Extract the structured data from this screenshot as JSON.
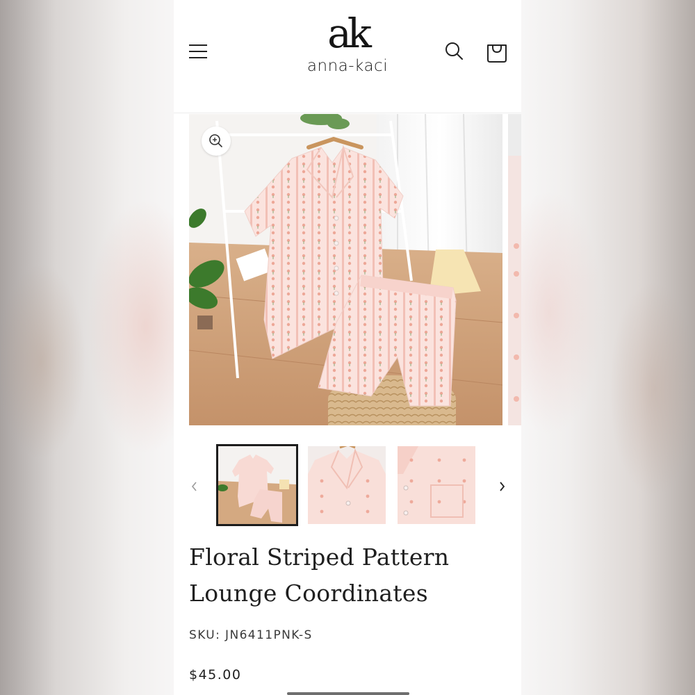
{
  "brand": {
    "logo_mark": "ak",
    "name": "anna-kaci"
  },
  "header": {
    "menu_icon": "hamburger-menu-icon",
    "search_icon": "search-icon",
    "cart_icon": "shopping-bag-icon"
  },
  "gallery": {
    "zoom_icon": "zoom-in-icon",
    "thumbnails": [
      {
        "id": "thumb-1",
        "active": true
      },
      {
        "id": "thumb-2",
        "active": false
      },
      {
        "id": "thumb-3",
        "active": false
      }
    ],
    "prev_icon": "chevron-left-icon",
    "next_icon": "chevron-right-icon"
  },
  "product": {
    "title_line1": "Floral Striped Pattern",
    "title_line2": "Lounge Coordinates",
    "sku": "SKU: JN6411PNK-S",
    "price": "$45.00"
  },
  "colors": {
    "text_primary": "#1f1f1f",
    "garment_pink": "#f6d8d4",
    "background": "#ffffff"
  }
}
